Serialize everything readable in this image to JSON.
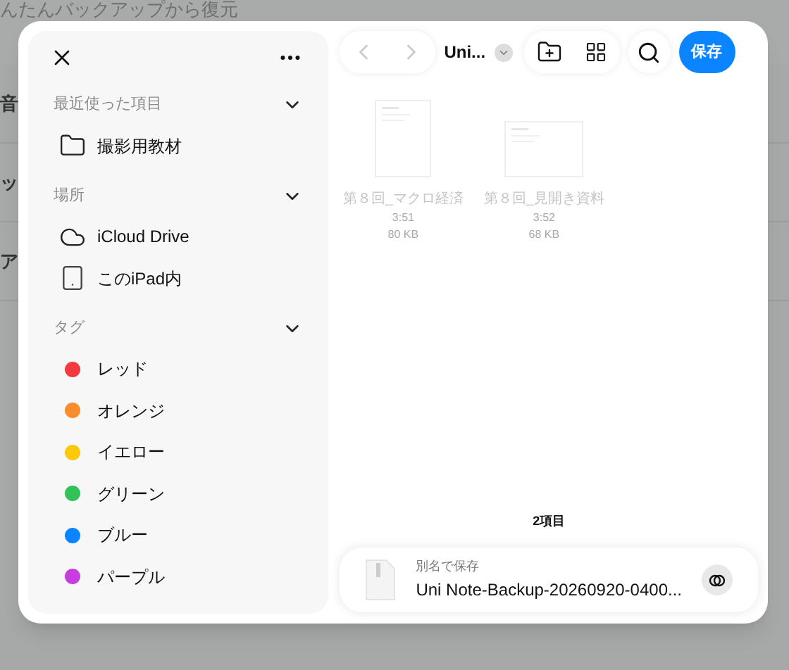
{
  "background_page": {
    "title": "んたんバックアップから復元",
    "rows": [
      "音",
      "ッ",
      "ア"
    ]
  },
  "sidebar": {
    "sections": [
      {
        "title": "最近使った項目",
        "expanded": true,
        "items": [
          {
            "kind": "folder",
            "label": "撮影用教材"
          }
        ]
      },
      {
        "title": "場所",
        "expanded": true,
        "items": [
          {
            "kind": "cloud",
            "label": "iCloud Drive"
          },
          {
            "kind": "ipad",
            "label": "このiPad内"
          }
        ]
      },
      {
        "title": "タグ",
        "expanded": true,
        "items": [
          {
            "kind": "tag",
            "label": "レッド",
            "color": "#f23a3f"
          },
          {
            "kind": "tag",
            "label": "オレンジ",
            "color": "#f98c2c"
          },
          {
            "kind": "tag",
            "label": "イエロー",
            "color": "#fdc80a"
          },
          {
            "kind": "tag",
            "label": "グリーン",
            "color": "#33c159"
          },
          {
            "kind": "tag",
            "label": "ブルー",
            "color": "#0a84ff"
          },
          {
            "kind": "tag",
            "label": "パープル",
            "color": "#c93ce0"
          }
        ]
      }
    ]
  },
  "toolbar": {
    "location": "Uni...",
    "save": "保存"
  },
  "files": [
    {
      "name": "第８回_マクロ経済",
      "time": "3:51",
      "size": "80 KB",
      "kind": "portrait"
    },
    {
      "name": "第８回_見開き資料",
      "time": "3:52",
      "size": "68 KB",
      "kind": "landscape"
    }
  ],
  "item_count": "2項目",
  "save_as": {
    "label": "別名で保存",
    "filename": "Uni Note-Backup-20260920-0400..."
  }
}
